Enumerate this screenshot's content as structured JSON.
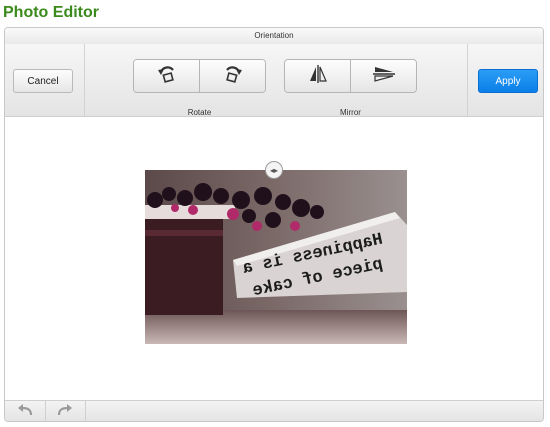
{
  "page": {
    "title": "Photo Editor"
  },
  "editor": {
    "section_title": "Orientation",
    "toolbar": {
      "cancel_label": "Cancel",
      "apply_label": "Apply",
      "rotate_label": "Rotate",
      "mirror_label": "Mirror"
    },
    "icons": {
      "rotate_left": "rotate-left-icon",
      "rotate_right": "rotate-right-icon",
      "flip_horizontal": "flip-horizontal-icon",
      "flip_vertical": "flip-vertical-icon",
      "undo": "undo-icon",
      "redo": "redo-icon",
      "compare_handle": "compare-handle-icon"
    },
    "photo": {
      "caption_line1": "Happiness is a",
      "caption_line2": "piece of cake"
    }
  },
  "colors": {
    "title": "#3a8a1c",
    "apply": "#0b7fe8"
  }
}
